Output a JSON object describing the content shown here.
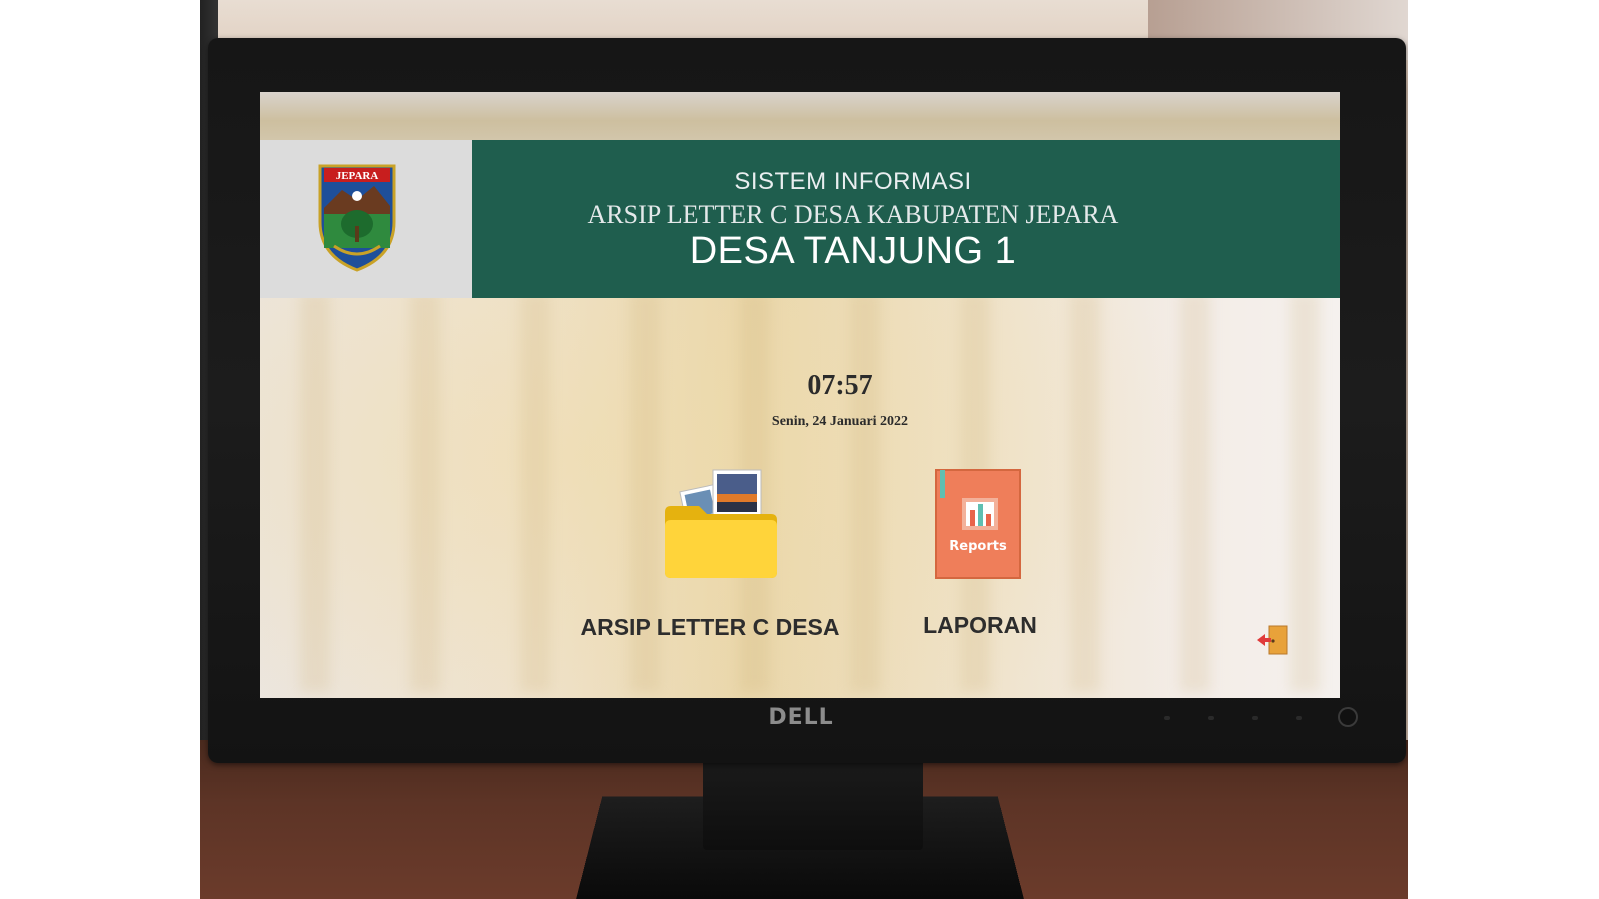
{
  "header": {
    "title_line1": "SISTEM INFORMASI",
    "title_line2": "ARSIP LETTER C DESA KABUPATEN JEPARA",
    "title_line3": "DESA TANJUNG 1",
    "band_color": "#1f5e4e",
    "logo_text": "JEPARA"
  },
  "clock": {
    "time": "07:57",
    "date": "Senin, 24 Januari 2022"
  },
  "menu": {
    "items": [
      {
        "label": "ARSIP LETTER C DESA",
        "icon": "folder-photos-icon"
      },
      {
        "label": "LAPORAN",
        "icon": "reports-book-icon",
        "icon_text": "Reports"
      }
    ]
  },
  "exit": {
    "icon": "exit-door-icon"
  },
  "monitor": {
    "brand": "DELL"
  }
}
